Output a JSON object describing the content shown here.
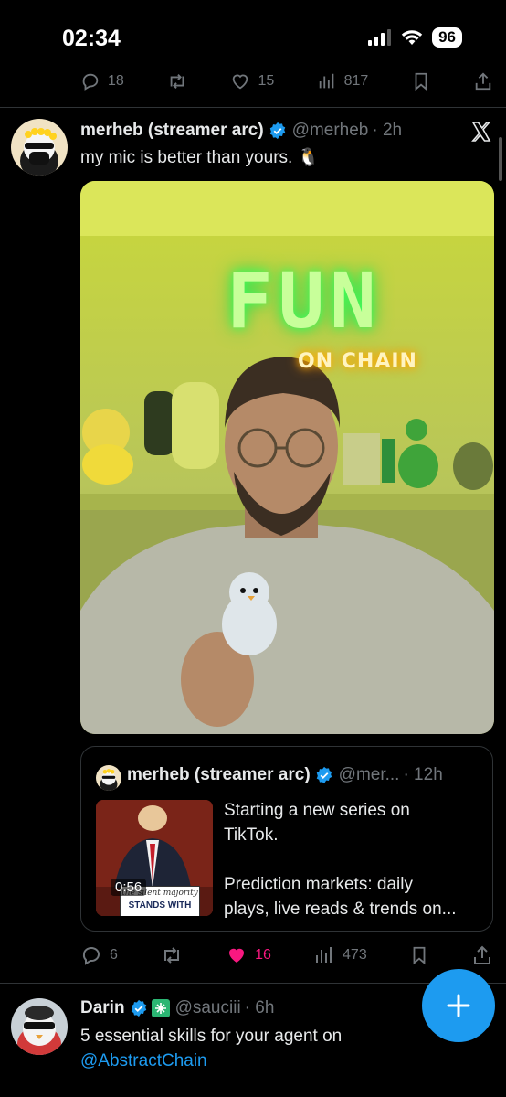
{
  "status": {
    "time": "02:34",
    "battery": "96"
  },
  "prev_actions": {
    "replies": "18",
    "likes": "15",
    "views": "817"
  },
  "tweet": {
    "name": "merheb (streamer arc)",
    "handle": "@merheb",
    "time": "· 2h",
    "text": "my mic is better than yours. 🐧",
    "neon_sign_main": "FUN",
    "neon_sign_sub": "ON CHAIN",
    "actions": {
      "replies": "6",
      "likes": "16",
      "views": "473"
    }
  },
  "quote": {
    "name": "merheb (streamer arc)",
    "handle": "@mer...",
    "time": "· 12h",
    "text_line1": "Starting a new series on",
    "text_line2": "TikTok.",
    "text_line3": "Prediction markets: daily",
    "text_line4": "plays, live reads & trends on...",
    "video_duration": "0:56",
    "video_caption_top": "the silent majority",
    "video_caption": "STANDS WITH"
  },
  "next_tweet": {
    "name": "Darin",
    "handle": "@sauciii",
    "time": "· 6h",
    "text_line1": "5 essential skills for your agent on",
    "mention": "@AbstractChain"
  },
  "colors": {
    "accent": "#1d9bf0",
    "like": "#f91880",
    "background": "#000000",
    "muted": "#71767b"
  },
  "icons": [
    "signal-icon",
    "wifi-icon",
    "reply-icon",
    "retweet-icon",
    "heart-icon",
    "views-icon",
    "bookmark-icon",
    "share-icon",
    "verified-icon",
    "x-logo-icon",
    "compose-plus-icon"
  ]
}
